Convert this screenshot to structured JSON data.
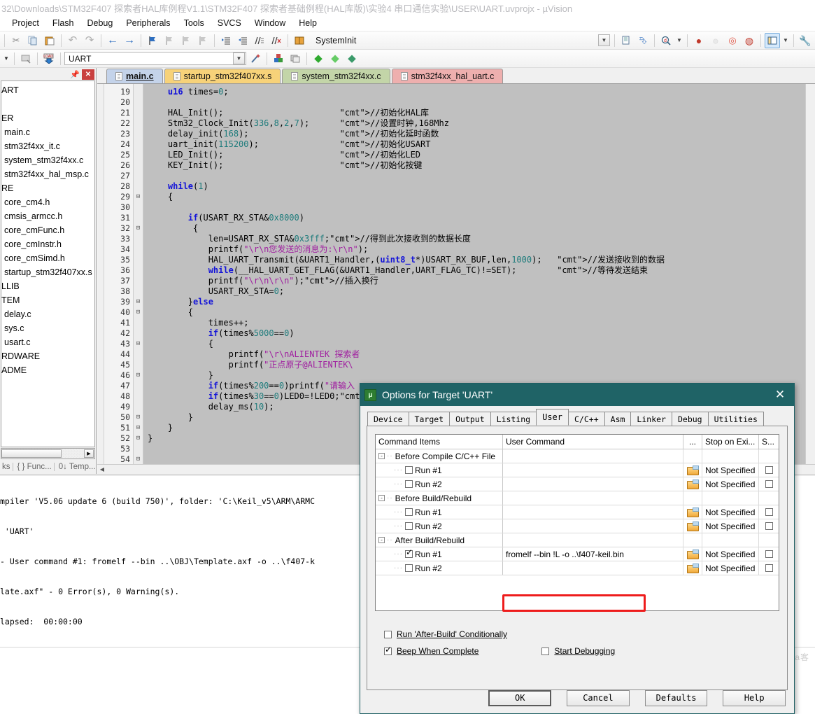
{
  "window": {
    "title": "32\\Downloads\\STM32F407 探索者HAL库例程V1.1\\STM32F407 探索者基础例程(HAL库版)\\实验4 串口通信实验\\USER\\UART.uvprojx - µVision"
  },
  "menu": {
    "items": [
      "Project",
      "Flash",
      "Debug",
      "Peripherals",
      "Tools",
      "SVCS",
      "Window",
      "Help"
    ]
  },
  "toolbar1": {
    "icons": [
      "cut-icon",
      "copy-icon",
      "paste-icon",
      "undo-icon",
      "redo-icon",
      "navigate-back-icon",
      "navigate-forward-icon",
      "bookmark-toggle-icon",
      "bookmark-prev-icon",
      "bookmark-next-icon",
      "bookmark-clear-icon",
      "indent-icon",
      "outdent-icon",
      "comment-icon",
      "uncomment-icon",
      "function-icon"
    ],
    "function_combo_value": "SystemInit",
    "right_icons": [
      "file-properties-icon",
      "find-in-files-icon",
      "magnifier-icon",
      "breakpoint-insert-icon",
      "breakpoint-disable-icon",
      "breakpoint-kill-all-icon",
      "breakpoint-disable-all-icon",
      "window-layout-icon",
      "configure-icon"
    ]
  },
  "toolbar2": {
    "icons": [
      "translate-icon",
      "build-icon",
      "rebuild-icon",
      "batch-build-icon",
      "stop-build-icon",
      "download-icon"
    ],
    "target_combo_value": "UART",
    "right_icons": [
      "target-options-icon",
      "manage-components-icon",
      "pack-installer-icon",
      "manage-runtime-icon",
      "svcs-icon"
    ]
  },
  "project_pane": {
    "header_icons": [
      "pin-icon",
      "close-icon"
    ],
    "tree": [
      "ART",
      "",
      "ER",
      "main.c",
      "stm32f4xx_it.c",
      "system_stm32f4xx.c",
      "stm32f4xx_hal_msp.c",
      "RE",
      "core_cm4.h",
      "cmsis_armcc.h",
      "core_cmFunc.h",
      "core_cmInstr.h",
      "core_cmSimd.h",
      "startup_stm32f407xx.s",
      "LLIB",
      "TEM",
      "delay.c",
      "sys.c",
      "usart.c",
      "RDWARE",
      "ADME"
    ],
    "pane_tabs": [
      "ks",
      "{ } Func...",
      "0↓ Temp..."
    ]
  },
  "editor": {
    "tabs": [
      {
        "label": "main.c",
        "active": true,
        "color": "#c4d3ea"
      },
      {
        "label": "startup_stm32f407xx.s",
        "active": false,
        "color": "#f7d279"
      },
      {
        "label": "system_stm32f4xx.c",
        "active": false,
        "color": "#c3d5a8"
      },
      {
        "label": "stm32f4xx_hal_uart.c",
        "active": false,
        "color": "#eeafae"
      }
    ],
    "first_line": 19,
    "lines": [
      {
        "n": 19,
        "fold": "",
        "code": "    u16 times=0;"
      },
      {
        "n": 20,
        "fold": "",
        "code": ""
      },
      {
        "n": 21,
        "fold": "",
        "code": "    HAL_Init();                       //初始化HAL库"
      },
      {
        "n": 22,
        "fold": "",
        "code": "    Stm32_Clock_Init(336,8,2,7);      //设置时钟,168Mhz"
      },
      {
        "n": 23,
        "fold": "",
        "code": "    delay_init(168);                  //初始化延时函数"
      },
      {
        "n": 24,
        "fold": "",
        "code": "    uart_init(115200);                //初始化USART"
      },
      {
        "n": 25,
        "fold": "",
        "code": "    LED_Init();                       //初始化LED"
      },
      {
        "n": 26,
        "fold": "",
        "code": "    KEY_Init();                       //初始化按键"
      },
      {
        "n": 27,
        "fold": "",
        "code": ""
      },
      {
        "n": 28,
        "fold": "",
        "code": "    while(1)"
      },
      {
        "n": 29,
        "fold": "-",
        "code": "    {"
      },
      {
        "n": 30,
        "fold": "",
        "code": ""
      },
      {
        "n": 31,
        "fold": "",
        "code": "        if(USART_RX_STA&0x8000)"
      },
      {
        "n": 32,
        "fold": "-",
        "code": "         {"
      },
      {
        "n": 33,
        "fold": "",
        "code": "            len=USART_RX_STA&0x3fff;//得到此次接收到的数据长度"
      },
      {
        "n": 34,
        "fold": "",
        "code": "            printf(\"\\r\\n您发送的消息为:\\r\\n\");"
      },
      {
        "n": 35,
        "fold": "",
        "code": "            HAL_UART_Transmit(&UART1_Handler,(uint8_t*)USART_RX_BUF,len,1000);   //发送接收到的数据"
      },
      {
        "n": 36,
        "fold": "",
        "code": "            while(__HAL_UART_GET_FLAG(&UART1_Handler,UART_FLAG_TC)!=SET);        //等待发送结束"
      },
      {
        "n": 37,
        "fold": "",
        "code": "            printf(\"\\r\\n\\r\\n\");//插入换行"
      },
      {
        "n": 38,
        "fold": "",
        "code": "            USART_RX_STA=0;"
      },
      {
        "n": 39,
        "fold": "-",
        "code": "        }else"
      },
      {
        "n": 40,
        "fold": "-",
        "code": "        {"
      },
      {
        "n": 41,
        "fold": "",
        "code": "            times++;"
      },
      {
        "n": 42,
        "fold": "",
        "code": "            if(times%5000==0)"
      },
      {
        "n": 43,
        "fold": "-",
        "code": "            {"
      },
      {
        "n": 44,
        "fold": "",
        "code": "                printf(\"\\r\\nALIENTEK 探索者"
      },
      {
        "n": 45,
        "fold": "",
        "code": "                printf(\"正点原子@ALIENTEK\\"
      },
      {
        "n": 46,
        "fold": "-",
        "code": "            }"
      },
      {
        "n": 47,
        "fold": "",
        "code": "            if(times%200==0)printf(\"请输入"
      },
      {
        "n": 48,
        "fold": "",
        "code": "            if(times%30==0)LED0=!LED0;//闪"
      },
      {
        "n": 49,
        "fold": "",
        "code": "            delay_ms(10);"
      },
      {
        "n": 50,
        "fold": "-",
        "code": "        }"
      },
      {
        "n": 51,
        "fold": "-",
        "code": "    }"
      },
      {
        "n": 52,
        "fold": "-",
        "code": "}"
      },
      {
        "n": 53,
        "fold": "",
        "code": ""
      },
      {
        "n": 54,
        "fold": "-",
        "code": ""
      }
    ]
  },
  "build_output": {
    "lines": [
      "mpiler 'V5.06 update 6 (build 750)', folder: 'C:\\Keil_v5\\ARM\\ARMC",
      " 'UART'",
      "- User command #1: fromelf --bin ..\\OBJ\\Template.axf -o ..\\f407-k",
      "late.axf\" - 0 Error(s), 0 Warning(s).",
      "lapsed:  00:00:00"
    ]
  },
  "dialog": {
    "title": "Options for Target 'UART'",
    "close_label": "✕",
    "tabs": [
      "Device",
      "Target",
      "Output",
      "Listing",
      "User",
      "C/C++",
      "Asm",
      "Linker",
      "Debug",
      "Utilities"
    ],
    "active_tab": "User",
    "table": {
      "headers": [
        "Command Items",
        "User Command",
        "...",
        "Stop on Exi...",
        "S..."
      ],
      "rows": [
        {
          "type": "group",
          "label": "Before Compile C/C++ File",
          "command": "",
          "stop": "",
          "checked": false,
          "has_browse": false,
          "has_stopcb": false
        },
        {
          "type": "item",
          "label": "Run #1",
          "command": "",
          "stop": "Not Specified",
          "checked": false,
          "has_browse": true,
          "has_stopcb": true
        },
        {
          "type": "item",
          "label": "Run #2",
          "command": "",
          "stop": "Not Specified",
          "checked": false,
          "has_browse": true,
          "has_stopcb": true
        },
        {
          "type": "group",
          "label": "Before Build/Rebuild",
          "command": "",
          "stop": "",
          "checked": false,
          "has_browse": false,
          "has_stopcb": false
        },
        {
          "type": "item",
          "label": "Run #1",
          "command": "",
          "stop": "Not Specified",
          "checked": false,
          "has_browse": true,
          "has_stopcb": true
        },
        {
          "type": "item",
          "label": "Run #2",
          "command": "",
          "stop": "Not Specified",
          "checked": false,
          "has_browse": true,
          "has_stopcb": true
        },
        {
          "type": "group",
          "label": "After Build/Rebuild",
          "command": "",
          "stop": "",
          "checked": false,
          "has_browse": false,
          "has_stopcb": false
        },
        {
          "type": "item",
          "label": "Run #1",
          "command": "fromelf --bin !L -o ..\\f407-keil.bin",
          "stop": "Not Specified",
          "checked": true,
          "has_browse": true,
          "has_stopcb": true,
          "highlighted": true
        },
        {
          "type": "item",
          "label": "Run #2",
          "command": "",
          "stop": "Not Specified",
          "checked": false,
          "has_browse": true,
          "has_stopcb": true
        }
      ]
    },
    "options": {
      "run_after_build_conditionally": {
        "label": "Run 'After-Build' Conditionally",
        "checked": false
      },
      "beep_when_complete": {
        "label": "Beep When Complete",
        "checked": true
      },
      "start_debugging": {
        "label": "Start Debugging",
        "checked": false
      }
    },
    "buttons": {
      "ok": "OK",
      "cancel": "Cancel",
      "defaults": "Defaults",
      "help": "Help"
    },
    "accent_color": "#1f6366",
    "highlight_color": "#ee1c1c"
  },
  "watermark": {
    "text": "@CSDN @标bia客"
  }
}
